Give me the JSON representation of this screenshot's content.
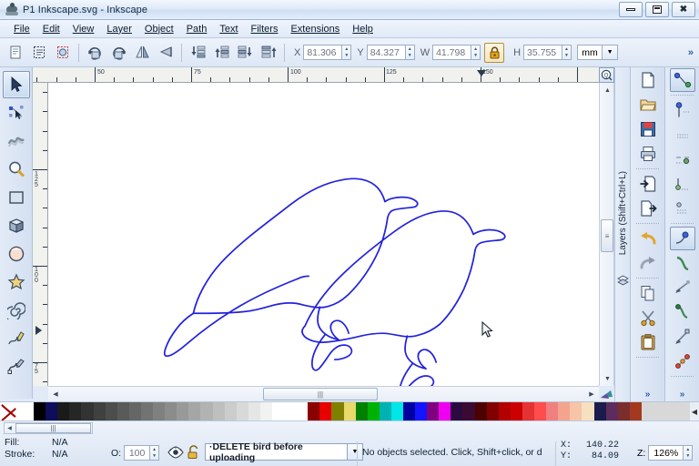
{
  "window": {
    "title": "P1 Inkscape.svg - Inkscape",
    "app_icon": "inkscape-logo-icon",
    "minimize_label": "Minimize",
    "restore_label": "Restore",
    "close_label": "Close"
  },
  "menu": {
    "items": [
      {
        "label": "File"
      },
      {
        "label": "Edit"
      },
      {
        "label": "View"
      },
      {
        "label": "Layer"
      },
      {
        "label": "Object"
      },
      {
        "label": "Path"
      },
      {
        "label": "Text"
      },
      {
        "label": "Filters"
      },
      {
        "label": "Extensions"
      },
      {
        "label": "Help"
      }
    ]
  },
  "tool_controls": {
    "buttons": [
      {
        "name": "select-all-button",
        "icon": "select-all-icon"
      },
      {
        "name": "select-all-in-layers-button",
        "icon": "select-all-layers-icon"
      },
      {
        "name": "deselect-button",
        "icon": "deselect-icon"
      },
      {
        "name": "rotate-ccw-button",
        "icon": "rotate-ccw-icon"
      },
      {
        "name": "rotate-cw-button",
        "icon": "rotate-cw-icon"
      },
      {
        "name": "flip-horizontal-button",
        "icon": "flip-horizontal-icon"
      },
      {
        "name": "flip-vertical-button",
        "icon": "flip-vertical-icon"
      },
      {
        "name": "lower-to-bottom-button",
        "icon": "lower-to-bottom-icon"
      },
      {
        "name": "raise-button",
        "icon": "raise-icon"
      },
      {
        "name": "lower-button",
        "icon": "lower-icon"
      },
      {
        "name": "raise-to-top-button",
        "icon": "raise-to-top-icon"
      }
    ],
    "x_label": "X",
    "x_value": "81.306",
    "y_label": "Y",
    "y_value": "84.327",
    "w_label": "W",
    "w_value": "41.798",
    "lock_icon": "lock-closed-icon",
    "h_label": "H",
    "h_value": "35.755",
    "units_value": "mm",
    "overflow_label": "»"
  },
  "toolbox": {
    "items": [
      {
        "name": "selector-tool",
        "icon": "arrow-cursor-icon",
        "active": true
      },
      {
        "name": "node-tool",
        "icon": "node-editor-icon",
        "active": false
      },
      {
        "name": "tweak-tool",
        "icon": "tweak-wave-icon",
        "active": false
      },
      {
        "name": "zoom-tool",
        "icon": "magnifier-icon",
        "active": false
      },
      {
        "name": "rectangle-tool",
        "icon": "rectangle-icon",
        "active": false
      },
      {
        "name": "box3d-tool",
        "icon": "cube-3d-icon",
        "active": false
      },
      {
        "name": "ellipse-tool",
        "icon": "circle-icon",
        "active": false
      },
      {
        "name": "star-tool",
        "icon": "star-icon",
        "active": false
      },
      {
        "name": "spiral-tool",
        "icon": "spiral-icon",
        "active": false
      },
      {
        "name": "pencil-tool",
        "icon": "pencil-icon",
        "active": false
      },
      {
        "name": "bezier-tool",
        "icon": "bezier-pen-icon",
        "active": false
      }
    ]
  },
  "rulers": {
    "unit": "mm",
    "horizontal_labels": [
      "50",
      "75",
      "100",
      "125",
      "150"
    ],
    "vertical_labels": [
      "125",
      "100",
      "75"
    ]
  },
  "canvas": {
    "drawing_name": "two-bird-outlines",
    "stroke_color": "#2222dd",
    "background": "#ffffff",
    "cursor_position_label": "mouse-cursor"
  },
  "dock": {
    "layers_tab_label": "Layers (Shift+Ctrl+L)",
    "layers_tab_icon": "layers-icon"
  },
  "right_commands": {
    "column1": [
      {
        "name": "new-document-button",
        "icon": "new-file-icon"
      },
      {
        "name": "open-document-button",
        "icon": "open-folder-icon"
      },
      {
        "name": "save-document-button",
        "icon": "floppy-save-icon"
      },
      {
        "name": "print-document-button",
        "icon": "printer-icon"
      },
      {
        "name": "import-button",
        "icon": "import-icon"
      },
      {
        "name": "export-button",
        "icon": "export-icon"
      },
      {
        "name": "undo-button",
        "icon": "undo-arrow-icon"
      },
      {
        "name": "redo-button",
        "icon": "redo-arrow-icon"
      },
      {
        "name": "copy-button",
        "icon": "copy-icon"
      },
      {
        "name": "cut-button",
        "icon": "scissors-icon"
      },
      {
        "name": "paste-button",
        "icon": "clipboard-paste-icon"
      }
    ],
    "column2": [
      {
        "name": "path-union-button",
        "icon": "node-path-icon",
        "active": true
      },
      {
        "name": "insert-node-button",
        "icon": "insert-node-icon"
      },
      {
        "name": "delete-node-button",
        "icon": "delete-node-icon"
      },
      {
        "name": "break-path-button",
        "icon": "break-path-icon"
      },
      {
        "name": "join-node-button",
        "icon": "join-node-icon"
      },
      {
        "name": "join-segment-button",
        "icon": "join-segment-icon"
      },
      {
        "name": "make-corner-button",
        "icon": "corner-node-icon",
        "active": true
      },
      {
        "name": "make-smooth-button",
        "icon": "smooth-node-icon"
      },
      {
        "name": "make-symmetric-button",
        "icon": "symmetric-node-icon"
      },
      {
        "name": "make-auto-button",
        "icon": "auto-node-icon"
      },
      {
        "name": "line-segment-button",
        "icon": "line-segment-icon"
      },
      {
        "name": "object-to-path-button",
        "icon": "object-to-path-icon"
      }
    ],
    "overflow_label": "»"
  },
  "palette": {
    "name": "Inkscape default palette",
    "none_swatch_label": "None",
    "colors": [
      "#ffffff",
      "#000000",
      "#0d0d5c",
      "#1a1a1a",
      "#262626",
      "#333333",
      "#404040",
      "#4d4d4d",
      "#5a5a5a",
      "#666666",
      "#737373",
      "#808080",
      "#8c8c8c",
      "#999999",
      "#a6a6a6",
      "#b3b3b3",
      "#bfbfbf",
      "#cccccc",
      "#d9d9d9",
      "#e6e6e6",
      "#f2f2f2",
      "#ffffff",
      "#ffffff",
      "#ffffff",
      "#8b0000",
      "#e60000",
      "#808000",
      "#e8d96a",
      "#008000",
      "#00b200",
      "#00b2b2",
      "#00e5e5",
      "#0000a0",
      "#1414ff",
      "#800080",
      "#f000f0",
      "#2b0b3f",
      "#3a0a32",
      "#4d0000",
      "#800000",
      "#b30000",
      "#cc0000",
      "#e53333",
      "#ff4d4d",
      "#f08080",
      "#f4a38f",
      "#f7c4a8",
      "#f5e0c0",
      "#1b1b4d",
      "#5c2d5c",
      "#7a2d2d",
      "#a33a1f"
    ]
  },
  "statusbar": {
    "fill_label": "Fill:",
    "fill_value": "N/A",
    "stroke_label": "Stroke:",
    "stroke_value": "N/A",
    "opacity_label": "O:",
    "opacity_value": "100",
    "visibility_icon": "eye-open-icon",
    "lock_icon": "lock-open-icon",
    "layer_name": "·DELETE bird before uploading",
    "message": "No objects selected. Click, Shift+click, or d",
    "x_label": "X:",
    "x_value": "140.22",
    "y_label": "Y:",
    "y_value": "84.09",
    "zoom_label": "Z:",
    "zoom_value": "126%"
  }
}
